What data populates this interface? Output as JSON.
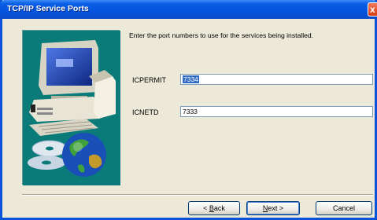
{
  "window": {
    "title": "TCP/IP Service Ports",
    "close_glyph": "x"
  },
  "prompt": "Enter the port numbers to use for the services being installed.",
  "fields": [
    {
      "label": "ICPERMIT",
      "value": "7334",
      "selected": true
    },
    {
      "label": "ICNETD",
      "value": "7333",
      "selected": false
    }
  ],
  "buttons": {
    "back": {
      "pre": "< ",
      "mnemonic": "B",
      "post": "ack"
    },
    "next": {
      "mnemonic": "N",
      "post": "ext >"
    },
    "cancel": "Cancel"
  },
  "icons": [
    "computer-illustration",
    "cd-discs",
    "globe",
    "close-icon"
  ],
  "colors": {
    "titlebar": "#0654de",
    "side_panel": "#0b7b79",
    "dialog_bg": "#ece9d8"
  }
}
